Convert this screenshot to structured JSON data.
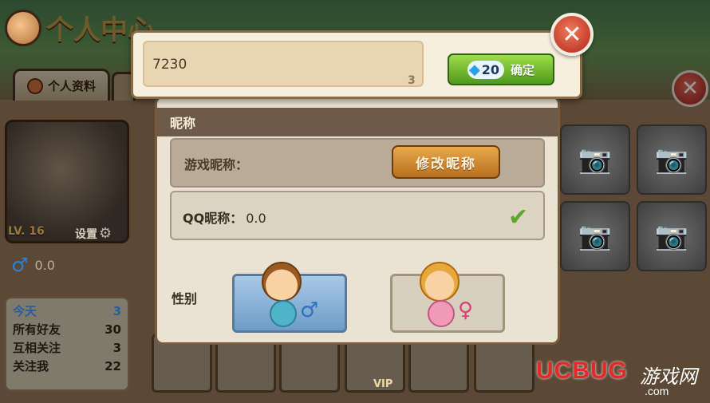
{
  "header": {
    "title": "个人中心",
    "close_glyph": "✕"
  },
  "tabs": [
    {
      "label": "个人资料"
    }
  ],
  "profile": {
    "level": "LV. 16",
    "settings_label": "设置",
    "gender_value": "0.0",
    "stats": [
      {
        "label": "今天",
        "value": "3"
      },
      {
        "label": "所有好友",
        "value": "30"
      },
      {
        "label": "互相关注",
        "value": "3"
      },
      {
        "label": "关注我",
        "value": "22"
      }
    ]
  },
  "friends": {
    "vip_label": "VIP"
  },
  "nickname_dialog": {
    "header": "昵称",
    "game_nickname_label": "游戏昵称：",
    "edit_nickname_button": "修改昵称",
    "qq_nickname_label": "QQ昵称：",
    "qq_nickname_value": "0.0",
    "gender_label": "性别"
  },
  "input_dialog": {
    "input_value": "7230",
    "char_count": "3",
    "cost": "20",
    "confirm_label": "确定",
    "close_glyph": "✕"
  },
  "watermark": {
    "brand": "UCBUG",
    "cn": "游戏网",
    "domain": ".com"
  },
  "colors": {
    "accent_green": "#4f9a1a",
    "close_red": "#b2261a",
    "male_blue": "#2f7fd6",
    "female_pink": "#d8407a"
  }
}
